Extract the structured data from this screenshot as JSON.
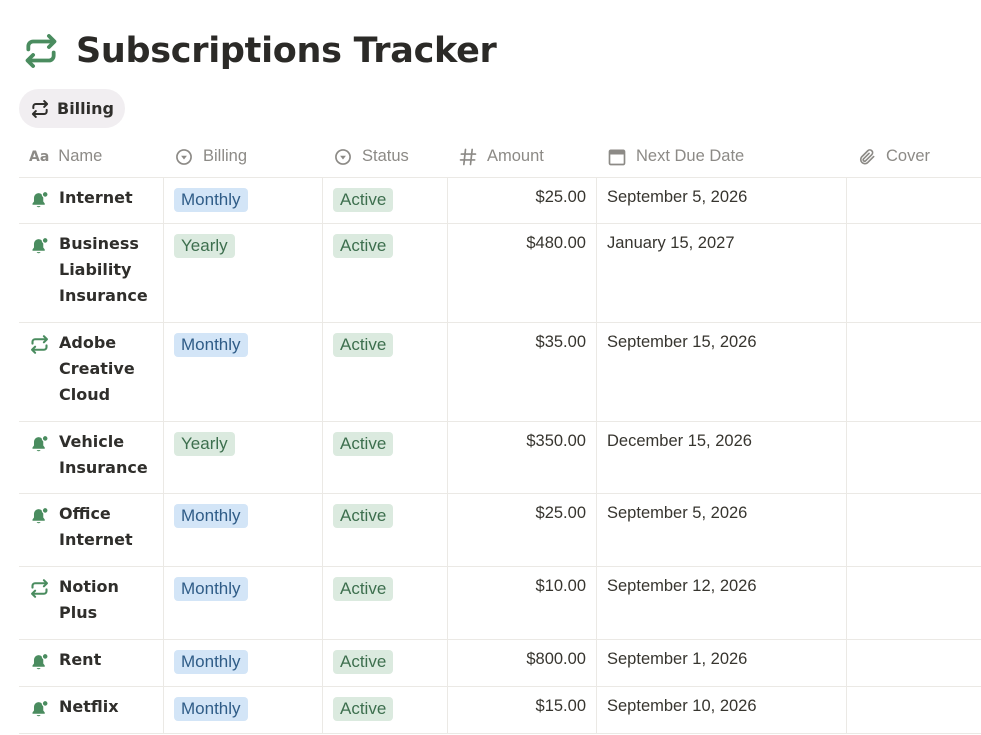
{
  "page": {
    "title": "Subscriptions Tracker",
    "title_icon": "repeat-icon",
    "accent_color": "#4a8c5f"
  },
  "view_tab": {
    "label": "Billing",
    "icon": "repeat-icon"
  },
  "columns": [
    {
      "label": "Name",
      "icon": "text-aa-icon"
    },
    {
      "label": "Billing",
      "icon": "select-circle-icon"
    },
    {
      "label": "Status",
      "icon": "status-circle-icon"
    },
    {
      "label": "Amount",
      "icon": "hash-icon"
    },
    {
      "label": "Next Due Date",
      "icon": "calendar-icon"
    },
    {
      "label": "Cover",
      "icon": "paperclip-icon"
    }
  ],
  "rows": [
    {
      "name": "Internet",
      "icon": "bell-icon",
      "billing": "Monthly",
      "status": "Active",
      "amount": "$25.00",
      "due": "September 5, 2026"
    },
    {
      "name": "Business Liability Insurance",
      "icon": "bell-icon",
      "billing": "Yearly",
      "status": "Active",
      "amount": "$480.00",
      "due": "January 15, 2027"
    },
    {
      "name": "Adobe Creative Cloud",
      "icon": "repeat-icon",
      "billing": "Monthly",
      "status": "Active",
      "amount": "$35.00",
      "due": "September 15, 2026"
    },
    {
      "name": "Vehicle Insurance",
      "icon": "bell-icon",
      "billing": "Yearly",
      "status": "Active",
      "amount": "$350.00",
      "due": "December 15, 2026"
    },
    {
      "name": "Office Internet",
      "icon": "bell-icon",
      "billing": "Monthly",
      "status": "Active",
      "amount": "$25.00",
      "due": "September 5, 2026"
    },
    {
      "name": "Notion Plus",
      "icon": "repeat-icon",
      "billing": "Monthly",
      "status": "Active",
      "amount": "$10.00",
      "due": "September 12, 2026"
    },
    {
      "name": "Rent",
      "icon": "bell-icon",
      "billing": "Monthly",
      "status": "Active",
      "amount": "$800.00",
      "due": "September 1, 2026"
    },
    {
      "name": "Netflix",
      "icon": "bell-icon",
      "billing": "Monthly",
      "status": "Active",
      "amount": "$15.00",
      "due": "September 10, 2026"
    }
  ],
  "colors": {
    "monthly_tag_bg": "#d3e5f7",
    "yearly_tag_bg": "#dbeadf",
    "active_tag_bg": "#dbeadf",
    "icon_green": "#4a8c5f"
  }
}
